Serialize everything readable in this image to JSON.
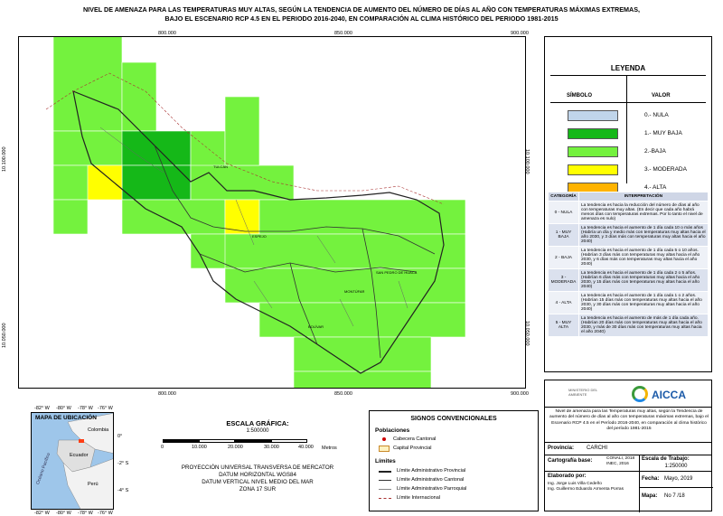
{
  "title_lines": [
    "NIVEL DE AMENAZA PARA LAS TEMPERATURAS MUY ALTAS, SEGÚN LA TENDENCIA DE AUMENTO DEL NÚMERO DE DÍAS AL AÑO CON TEMPERATURAS MÁXIMAS EXTREMAS,",
    "BAJO EL ESCENARIO RCP 4.5 EN EL PERIODO 2016-2040, EN COMPARACIÓN AL CLIMA HISTÓRICO DEL PERIODO 1981-2015"
  ],
  "map": {
    "x_ticks": [
      "800.000",
      "850.000",
      "900.000"
    ],
    "y_ticks": [
      "10.100.000",
      "10.050.000"
    ],
    "place_labels": [
      "TULCÁN",
      "ESPEJO",
      "SAN PEDRO DE HUACA",
      "MONTÚFAR",
      "BOLÍVAR"
    ],
    "colors": {
      "baja": "#74f23e",
      "muy_baja": "#15b818",
      "moderada": "#ffff00",
      "alta": "#ffb300",
      "muy_alta": "#ff3d14",
      "nula": "#c0d5ea"
    }
  },
  "legend": {
    "title": "LEYENDA",
    "col_symbol": "SÍMBOLO",
    "col_value": "VALOR",
    "items": [
      {
        "label": "0.- NULA",
        "color": "#c0d5ea"
      },
      {
        "label": "1.- MUY BAJA",
        "color": "#15b818"
      },
      {
        "label": "2.-BAJA",
        "color": "#74f23e"
      },
      {
        "label": "3.- MODERADA",
        "color": "#ffff00"
      },
      {
        "label": "4.- ALTA",
        "color": "#ffb300"
      },
      {
        "label": "5.- MUY ALTA",
        "color": "#ff3d14"
      }
    ]
  },
  "interpretation": {
    "col_cat": "CATEGORÍA",
    "col_interp": "INTERPRETACIÓN",
    "rows": [
      {
        "cat": "0 - NULA",
        "text": "La tendencia es hacia la reducción del número de días al año con temperaturas muy altas. (En decir que cada año habrá menos días con temperaturas extremas. Por lo tanto el nivel de amenaza es nulo)"
      },
      {
        "cat": "1 - MUY BAJA",
        "text": "La tendencia es hacia el aumento de 1 día cada 10 o más años (Habría un día y medio más con temperaturas muy altas hacia el año 2030, y 3 días más con temperaturas muy altas hacia el año 2040)"
      },
      {
        "cat": "2 - BAJA",
        "text": "La tendencia es hacia el aumento de 1 día cada 5 o 10 años. (Habrían 3 días más con temperaturas muy altas hacia el año 2030, y 6 días más con temperaturas muy altas hacia el año 2040)"
      },
      {
        "cat": "3 - MODERADA",
        "text": "La tendencia es hacia el aumento de 1 día cada 2 o 5 años. (Habrían 6 días más con temperaturas muy altas hacia el año 2030, y 15 días más con temperaturas muy altas hacia el año 2040)"
      },
      {
        "cat": "4 - ALTA",
        "text": "La tendencia es hacia el aumento de 1 día cada 1 o 2 años. (Habrían 15 días más con temperaturas muy altas hacia el año 2030, y 30 días más con temperaturas muy altas hacia el año 2040)"
      },
      {
        "cat": "5 - MUY ALTA",
        "text": "La tendencia es hacia el aumento de más de 1 día cada año. (Habrían 20 días más con temperaturas muy altas hacia el año 2030, y más de 30 días más con temperaturas muy altas hacia el año 2040)"
      }
    ]
  },
  "location_map": {
    "title": "MAPA DE UBICACIÓN",
    "labels": [
      "Colombia",
      "Ecuador",
      "Perú",
      "Océano Pacífico"
    ],
    "top_ticks": [
      "-82° W",
      "-80° W",
      "-78° W",
      "-76° W"
    ],
    "bottom_ticks": [
      "-82° W",
      "-80° W",
      "-78° W",
      "-76° W"
    ],
    "side_ticks": [
      "0°",
      "-2° S",
      "-4° S"
    ]
  },
  "scale": {
    "title": "ESCALA GRÁFICA:",
    "ratio": "1:500000",
    "ticks": [
      "0",
      "10.000",
      "20.000",
      "30.000",
      "40.000"
    ],
    "unit": "Metros",
    "projection_lines": [
      "PROYECCIÓN UNIVERSAL TRANSVERSA DE MERCATOR",
      "DATUM HORIZONTAL WGS84",
      "DATUM VERTICAL NIVEL MEDIO DEL MAR",
      "ZONA 17 SUR"
    ]
  },
  "signs": {
    "title": "SIGNOS CONVENCIONALES",
    "poblaciones": "Poblaciones",
    "cabecera": "Cabecera Cantonal",
    "capital": "Capital Provincial",
    "limites": "Límites",
    "limit_items": [
      "Límite Administrativo Provincial",
      "Límite Administrativo Cantonal",
      "Límite Administrativo Parroquial",
      "Límite Internacional"
    ]
  },
  "info": {
    "logo_text": "AICCA",
    "ministry": "MINISTERIO DEL AMBIENTE",
    "description": "Nivel de amenaza para las Temperaturas muy altas, según la Tendencia de aumento del número de días al año con temperaturas máximas extremas, bajo el Escenario RCP 4.5 en el Período 2016-2040, en comparación al clima histórico del período 1981-2015",
    "provincia_label": "Provincia:",
    "provincia_value": "CARCHI",
    "cartografia_label": "Cartografía base:",
    "cartografia_value": "CONALI, 2018 INEC, 2016",
    "escala_label": "Escala de Trabajo:",
    "escala_value": "1:250000",
    "elaborado_label": "Elaborado por:",
    "elaborado_lines": [
      "Ing. Jorge Luis Villa Cedeño",
      "Ing. Guillermo Eduardo Armenta Porras"
    ],
    "fecha_label": "Fecha:",
    "fecha_value": "Mayo, 2019",
    "mapa_label": "Mapa:",
    "mapa_value": "No 7 /18"
  }
}
